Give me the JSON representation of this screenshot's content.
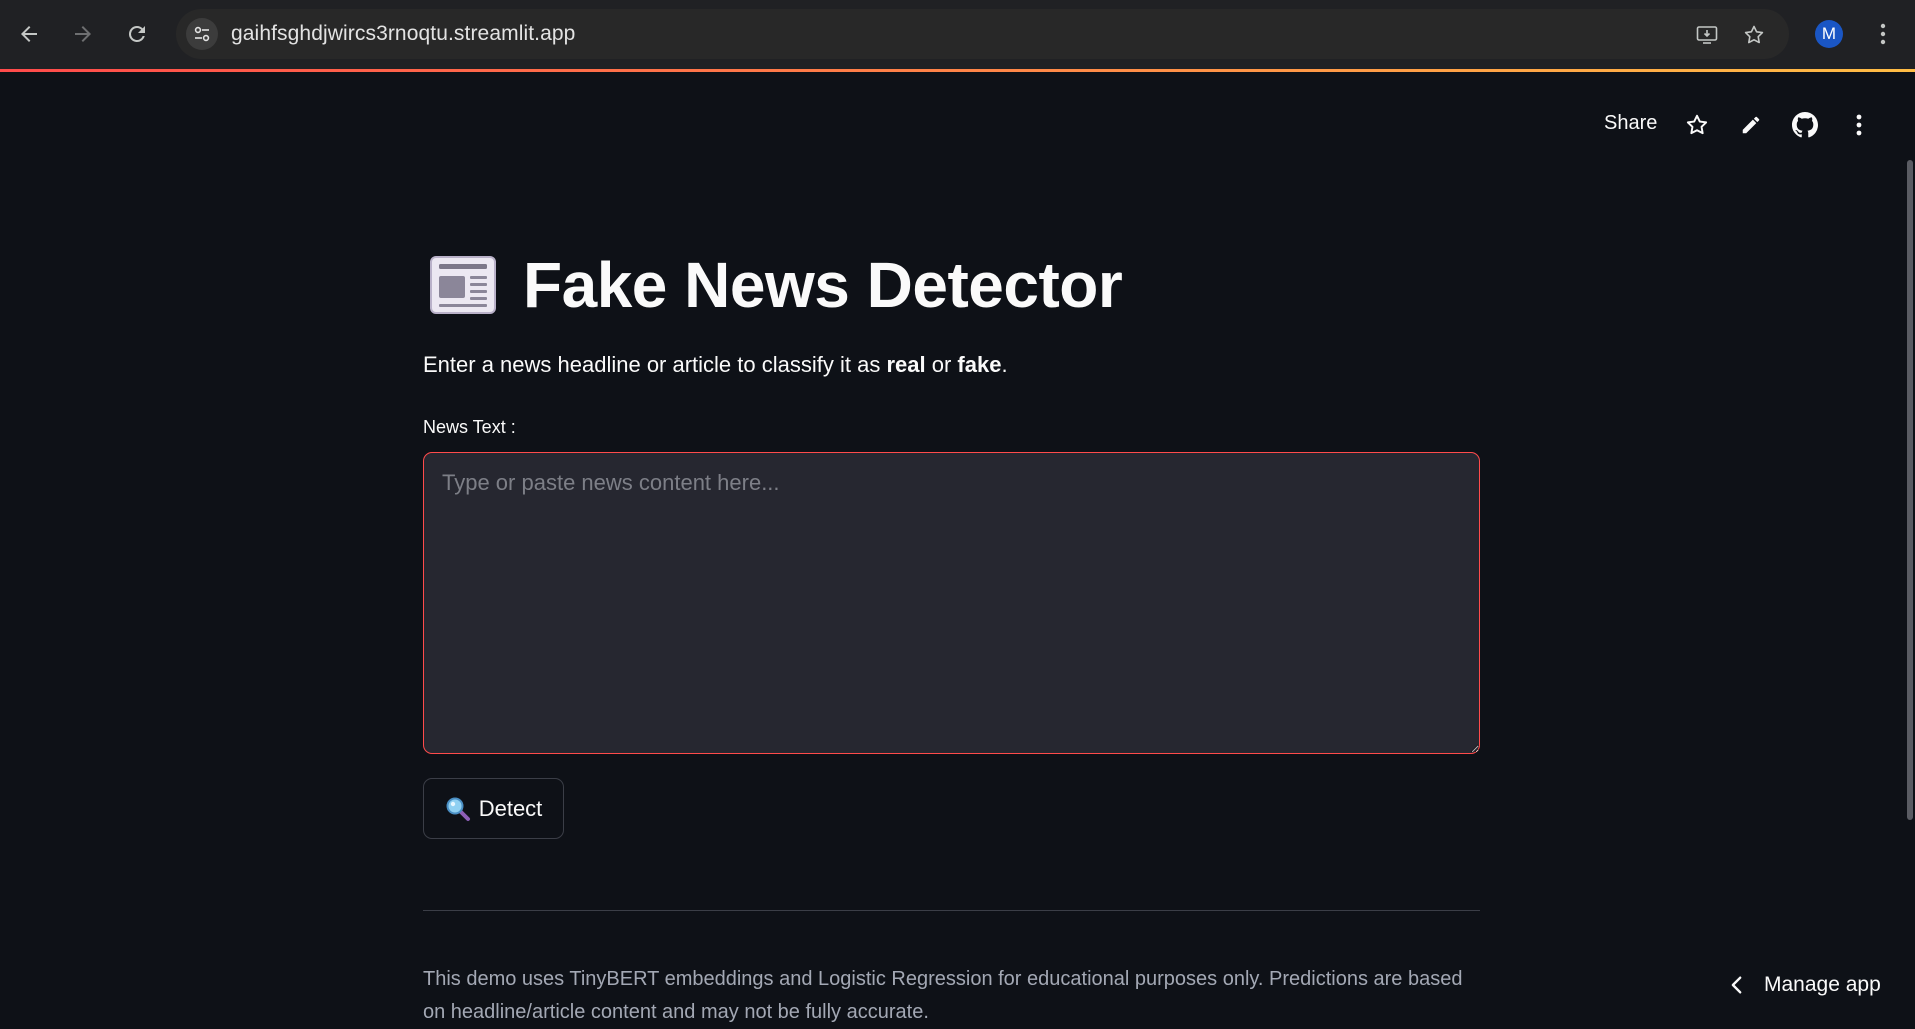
{
  "browser": {
    "url": "gaihfsghdjwircs3rnoqtu.streamlit.app",
    "profile_initial": "M",
    "icons": [
      "back-arrow-icon",
      "forward-arrow-icon",
      "reload-icon",
      "site-settings-icon",
      "install-app-icon",
      "bookmark-star-icon",
      "kebab-menu-icon"
    ]
  },
  "toolbar": {
    "share_label": "Share",
    "icons": [
      "favorite-star-icon",
      "edit-pencil-icon",
      "github-icon",
      "more-menu-icon"
    ]
  },
  "app": {
    "title_icon": "newspaper-icon",
    "title": "Fake News Detector",
    "subtitle_before": "Enter a news headline or article to classify it as ",
    "subtitle_real": "real",
    "subtitle_middle": " or ",
    "subtitle_fake": "fake",
    "subtitle_after": ".",
    "field_label": "News Text :",
    "textarea_value": "",
    "textarea_placeholder": "Type or paste news content here...",
    "detect_label": "Detect",
    "detect_icon": "magnifying-glass-icon",
    "footnote": "This demo uses TinyBERT embeddings and Logistic Regression for educational purposes only. Predictions are based on headline/article content and may not be fully accurate."
  },
  "manage": {
    "label": "Manage app"
  },
  "colors": {
    "background": "#0e1117",
    "accent": "#ff4b4b",
    "input_bg": "#262730",
    "text": "#fafafa",
    "muted_text": "#a3a8b4"
  }
}
